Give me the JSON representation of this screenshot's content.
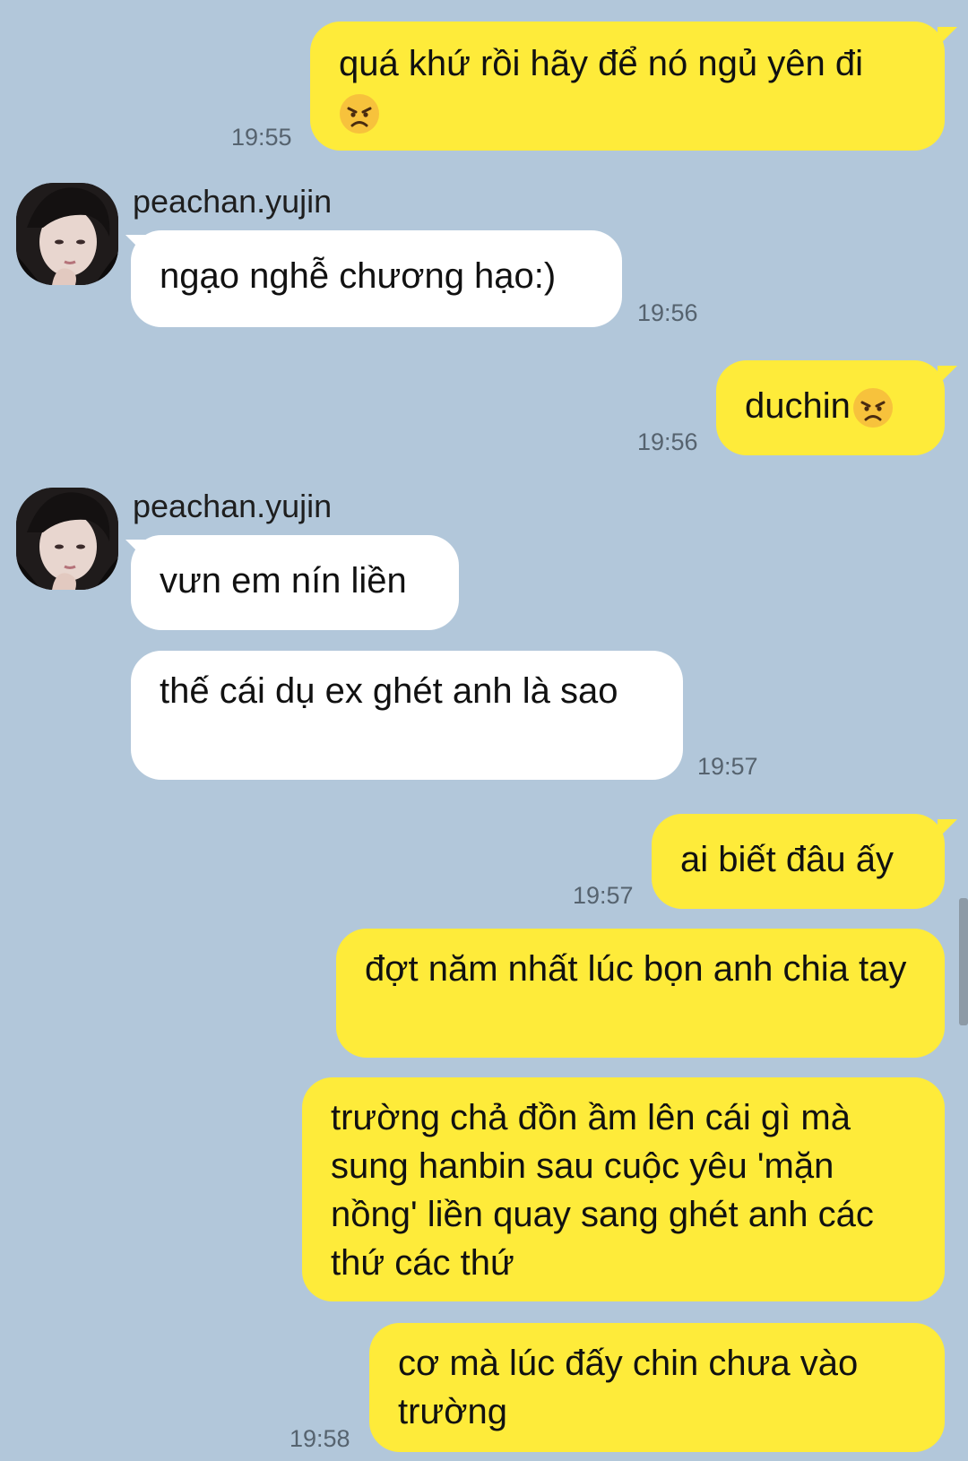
{
  "contact": {
    "name": "peachan.yujin"
  },
  "colors": {
    "background": "#b2c7da",
    "my_bubble": "#feeb3a",
    "their_bubble": "#ffffff",
    "timestamp": "#56636f"
  },
  "messages": [
    {
      "from": "me",
      "text": "quá khứ rồi hãy để nó ngủ yên đi",
      "emoji": "angry-face",
      "time": "19:55"
    },
    {
      "from": "them",
      "text": "ngạo nghễ chương hạo:)",
      "time": "19:56"
    },
    {
      "from": "me",
      "text": "duchin",
      "emoji": "angry-face",
      "time": "19:56"
    },
    {
      "from": "them",
      "text": "vưn em nín liền"
    },
    {
      "from": "them",
      "text": "thế cái dụ ex ghét anh là sao",
      "time": "19:57"
    },
    {
      "from": "me",
      "text": "ai biết đâu ấy",
      "time": "19:57"
    },
    {
      "from": "me",
      "text": "đợt năm nhất lúc bọn anh chia tay"
    },
    {
      "from": "me",
      "text": "trường chả đồn ầm lên cái gì mà sung hanbin sau cuộc yêu 'mặn nồng' liền quay sang ghét anh các thứ các thứ"
    },
    {
      "from": "me",
      "text": "cơ mà lúc đấy chin chưa vào trường",
      "time": "19:58"
    }
  ]
}
